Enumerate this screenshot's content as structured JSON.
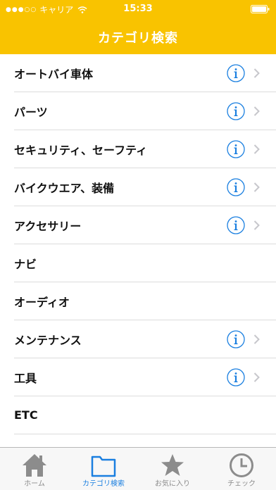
{
  "status_bar": {
    "carrier": "キャリア",
    "time": "15:33"
  },
  "nav": {
    "title": "カテゴリ検索"
  },
  "categories": [
    {
      "label": "オートバイ車体",
      "has_info": true
    },
    {
      "label": "パーツ",
      "has_info": true
    },
    {
      "label": "セキュリティ、セーフティ",
      "has_info": true
    },
    {
      "label": "バイクウエア、装備",
      "has_info": true
    },
    {
      "label": "アクセサリー",
      "has_info": true
    },
    {
      "label": "ナビ",
      "has_info": false
    },
    {
      "label": "オーディオ",
      "has_info": false
    },
    {
      "label": "メンテナンス",
      "has_info": true
    },
    {
      "label": "工具",
      "has_info": true
    },
    {
      "label": "ETC",
      "has_info": false
    }
  ],
  "tabbar": {
    "tabs": [
      {
        "label": "ホーム",
        "icon": "home-icon",
        "active": false
      },
      {
        "label": "カテゴリ検索",
        "icon": "folder-icon",
        "active": true
      },
      {
        "label": "お気に入り",
        "icon": "star-icon",
        "active": false
      },
      {
        "label": "チェック",
        "icon": "clock-icon",
        "active": false
      }
    ]
  },
  "colors": {
    "header_bg": "#f9c300",
    "accent_blue": "#1a7fe0",
    "inactive_gray": "#8c8c8c"
  }
}
